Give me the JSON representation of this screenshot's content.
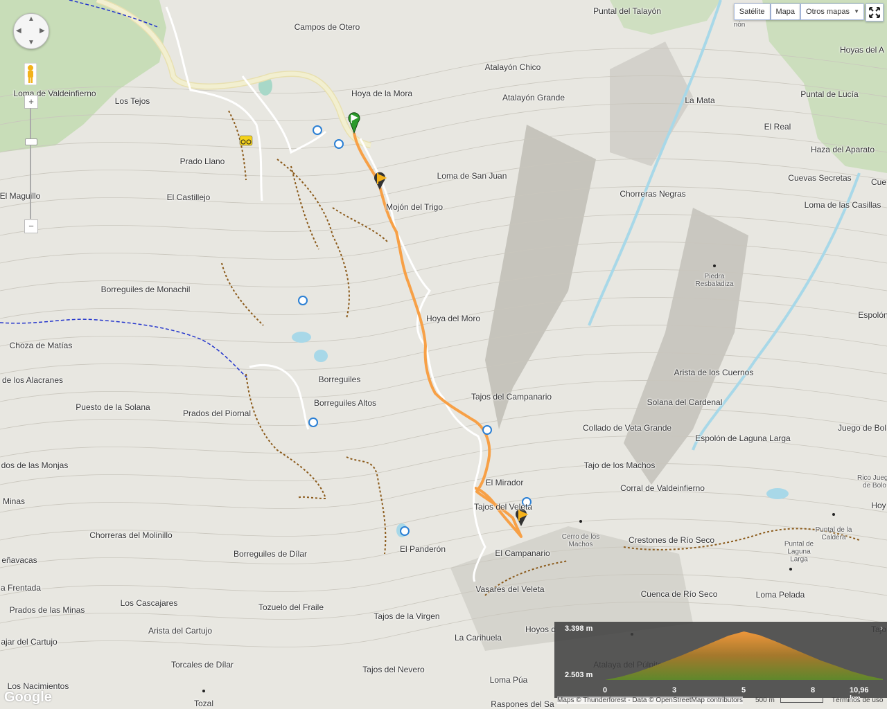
{
  "controls": {
    "map_types": [
      "Satélite",
      "Mapa",
      "Otros mapas"
    ],
    "fullscreen_icon": "fullscreen-icon",
    "zoom_in": "+",
    "zoom_out": "−"
  },
  "labels": [
    {
      "t": "Puntal del Talayón"
    },
    {
      "t": "Campos de Otero"
    },
    {
      "t": "Atalayón Chico"
    },
    {
      "t": "Atalayón Grande"
    },
    {
      "t": "Hoya de la Mora"
    },
    {
      "t": "Hoyas del A"
    },
    {
      "t": "Puntal de Lucía"
    },
    {
      "t": "La Mata"
    },
    {
      "t": "El Real"
    },
    {
      "t": "Haza del Aparato"
    },
    {
      "t": "Cuevas Secretas"
    },
    {
      "t": "Loma de las Casillas"
    },
    {
      "t": "Chorreras Negras"
    },
    {
      "t": "Loma de San Juan"
    },
    {
      "t": "Mojón del Trigo"
    },
    {
      "t": "Loma de Valdeinfierno"
    },
    {
      "t": "Los Tejos"
    },
    {
      "t": "Prado Llano"
    },
    {
      "t": "El Maguillo"
    },
    {
      "t": "El Castillejo"
    },
    {
      "t": "Borreguiles de Monachil"
    },
    {
      "t": "Hoya del Moro"
    },
    {
      "t": "Choza de Matías"
    },
    {
      "t": "de los Alacranes"
    },
    {
      "t": "Borreguiles"
    },
    {
      "t": "Borreguiles Altos"
    },
    {
      "t": "Puesto de la Solana"
    },
    {
      "t": "Prados del Piornal"
    },
    {
      "t": "Tajos del Campanario"
    },
    {
      "t": "Arista de los Cuernos"
    },
    {
      "t": "Solana del Cardenal"
    },
    {
      "t": "Collado de Veta Grande"
    },
    {
      "t": "Espolón de Laguna Larga"
    },
    {
      "t": "Juego de Bol"
    },
    {
      "t": "dos de las Monjas"
    },
    {
      "t": "Tajo de los Machos"
    },
    {
      "t": "El Mirador"
    },
    {
      "t": "Corral de Valdeinfierno"
    },
    {
      "t": "Minas"
    },
    {
      "t": "Tajos del Veleta"
    },
    {
      "t": "Chorreras del Molinillo"
    },
    {
      "t": "El Panderón"
    },
    {
      "t": "Borreguiles de Dílar"
    },
    {
      "t": "El Campanario"
    },
    {
      "t": "Crestones de Río Seco"
    },
    {
      "t": "eñavacas"
    },
    {
      "t": "a Frentada"
    },
    {
      "t": "Vasares del Veleta"
    },
    {
      "t": "Cuenca de Río Seco"
    },
    {
      "t": "Loma Pelada"
    },
    {
      "t": "Los Cascajares"
    },
    {
      "t": "Prados de las Minas"
    },
    {
      "t": "Tozuelo del Fraile"
    },
    {
      "t": "Tajos de la Virgen"
    },
    {
      "t": "Arista del Cartujo"
    },
    {
      "t": "ajar del Cartujo"
    },
    {
      "t": "La Carihuela"
    },
    {
      "t": "Hoyos d"
    },
    {
      "t": "Torcales de Dílar"
    },
    {
      "t": "Tajos del Nevero"
    },
    {
      "t": "Los Nacimientos"
    },
    {
      "t": "Loma Púa"
    },
    {
      "t": "Raspones del Sa"
    },
    {
      "t": "Espolón"
    },
    {
      "t": "Hoy"
    },
    {
      "t": "Tozal"
    },
    {
      "t": "Atalaya del Púlpito"
    },
    {
      "t": "Cue"
    },
    {
      "t": "Tajo"
    }
  ],
  "small_labels": [
    {
      "t": "Piedra Resbaladiza"
    },
    {
      "t": "Cerro de los Machos"
    },
    {
      "t": "Puntal de la Caldera"
    },
    {
      "t": "Puntal de Laguna Larga"
    },
    {
      "t": "Rico Juego de Bolo"
    },
    {
      "t": "nón"
    }
  ],
  "elevation": {
    "max": "3.398 m",
    "min": "2.503 m",
    "ticks": [
      "0",
      "3",
      "5",
      "8",
      "10,96 km"
    ],
    "profile": [
      2503,
      2560,
      2640,
      2740,
      2850,
      2960,
      3080,
      3200,
      3320,
      3398,
      3330,
      3220,
      3100,
      2980,
      2860,
      2760,
      2660,
      2580,
      2520
    ]
  },
  "footer": {
    "attribution": "Maps © Thunderforest - Data © OpenStreetMap contributors",
    "scale": "500 m",
    "terms": "Términos de uso",
    "google": "Google"
  },
  "colors": {
    "route": "#f7a046",
    "trail": "#8b5a1a",
    "boundary": "#2233cc",
    "forest": "#b8d8a8",
    "water": "#a8d8e8"
  }
}
